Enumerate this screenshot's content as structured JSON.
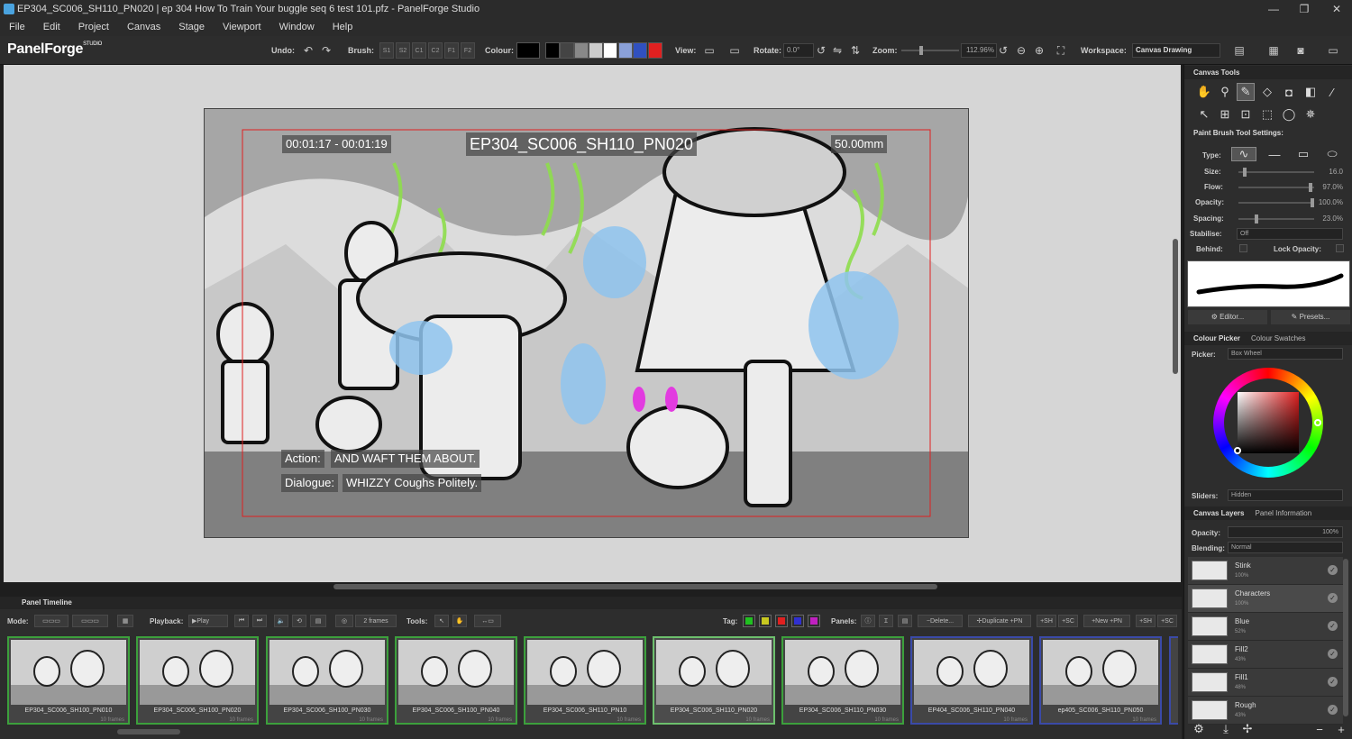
{
  "window": {
    "title": "EP304_SC006_SH110_PN020 | ep 304  How To Train Your buggle seq 6 test 101.pfz - PanelForge Studio"
  },
  "menu": [
    "File",
    "Edit",
    "Project",
    "Canvas",
    "Stage",
    "Viewport",
    "Window",
    "Help"
  ],
  "logo": {
    "name": "PanelForge",
    "suffix": "STUDIO"
  },
  "toolbar": {
    "undo_label": "Undo:",
    "brush_label": "Brush:",
    "brush_slots": [
      "S1",
      "S2",
      "C1",
      "C2",
      "F1",
      "F2"
    ],
    "colour_label": "Colour:",
    "colour_swatches": [
      "#000000",
      "#000000",
      "#444444",
      "#888888",
      "#cccccc",
      "#ffffff",
      "#8aa0d8",
      "#3050c0",
      "#e02020"
    ],
    "view_label": "View:",
    "rotate_label": "Rotate:",
    "rotate_value": "0.0°",
    "zoom_label": "Zoom:",
    "zoom_value": "112.96%",
    "workspace_label": "Workspace:",
    "workspace_value": "Canvas Drawing"
  },
  "canvas": {
    "timecode": "00:01:17 - 00:01:19",
    "panel_id": "EP304_SC006_SH110_PN020",
    "focal": "50.00mm",
    "action_label": "Action:",
    "action_text": "AND WAFT THEM ABOUT.",
    "dialogue_label": "Dialogue:",
    "dialogue_text": "WHIZZY Coughs Politely."
  },
  "canvas_tools": {
    "title": "Canvas Tools",
    "settings_title": "Paint Brush Tool Settings:",
    "type_label": "Type:",
    "size_label": "Size:",
    "size_value": "16.0",
    "size_level": 0.06,
    "flow_label": "Flow:",
    "flow_value": "97.0%",
    "flow_level": 0.97,
    "opacity_label": "Opacity:",
    "opacity_value": "100.0%",
    "opacity_level": 1.0,
    "spacing_label": "Spacing:",
    "spacing_value": "23.0%",
    "spacing_level": 0.23,
    "stabilise_label": "Stabilise:",
    "stabilise_value": "Off",
    "behind_label": "Behind:",
    "lock_label": "Lock Opacity:",
    "editor_label": "Editor...",
    "presets_label": "Presets..."
  },
  "colour": {
    "tab_picker": "Colour Picker",
    "tab_swatches": "Colour Swatches",
    "picker_label": "Picker:",
    "picker_value": "Box Wheel",
    "sliders_label": "Sliders:",
    "sliders_value": "Hidden"
  },
  "layers": {
    "tab_layers": "Canvas Layers",
    "tab_info": "Panel Information",
    "opacity_label": "Opacity:",
    "opacity_value": "100%",
    "blending_label": "Blending:",
    "blending_value": "Normal",
    "items": [
      {
        "name": "Stink",
        "pct": "100%"
      },
      {
        "name": "Characters",
        "pct": "100%"
      },
      {
        "name": "Blue",
        "pct": "52%"
      },
      {
        "name": "Fill2",
        "pct": "43%"
      },
      {
        "name": "Fill1",
        "pct": "48%"
      },
      {
        "name": "Rough",
        "pct": "43%"
      }
    ]
  },
  "timeline": {
    "title": "Panel Timeline",
    "mode_label": "Mode:",
    "playback_label": "Playback:",
    "play_label": "Play",
    "frames_value": "2 frames",
    "tools_label": "Tools:",
    "tag_label": "Tag:",
    "tag_colors": [
      "#20c020",
      "#c8c820",
      "#e02020",
      "#3030d0",
      "#c020c0"
    ],
    "panels_label": "Panels:",
    "delete_label": "Delete...",
    "duplicate_label": "Duplicate",
    "pn_label": "+PN",
    "sh_label": "+SH",
    "sc_label": "+SC",
    "new_label": "New",
    "panels": [
      {
        "name": "EP304_SC006_SH100_PN010",
        "frames": "10 frames",
        "c": "g"
      },
      {
        "name": "EP304_SC006_SH100_PN020",
        "frames": "10 frames",
        "c": "g"
      },
      {
        "name": "EP304_SC006_SH100_PN030",
        "frames": "10 frames",
        "c": "g"
      },
      {
        "name": "EP304_SC006_SH100_PN040",
        "frames": "10 frames",
        "c": "g"
      },
      {
        "name": "EP304_SC006_SH110_PN10",
        "frames": "10 frames",
        "c": "g"
      },
      {
        "name": "EP304_SC006_SH110_PN020",
        "frames": "10 frames",
        "c": "s"
      },
      {
        "name": "EP304_SC006_SH110_PN030",
        "frames": "10 frames",
        "c": "g"
      },
      {
        "name": "EP404_SC006_SH110_PN040",
        "frames": "10 frames",
        "c": "b"
      },
      {
        "name": "ep405_SC006_SH110_PN050",
        "frames": "10 frames",
        "c": "b"
      }
    ]
  }
}
